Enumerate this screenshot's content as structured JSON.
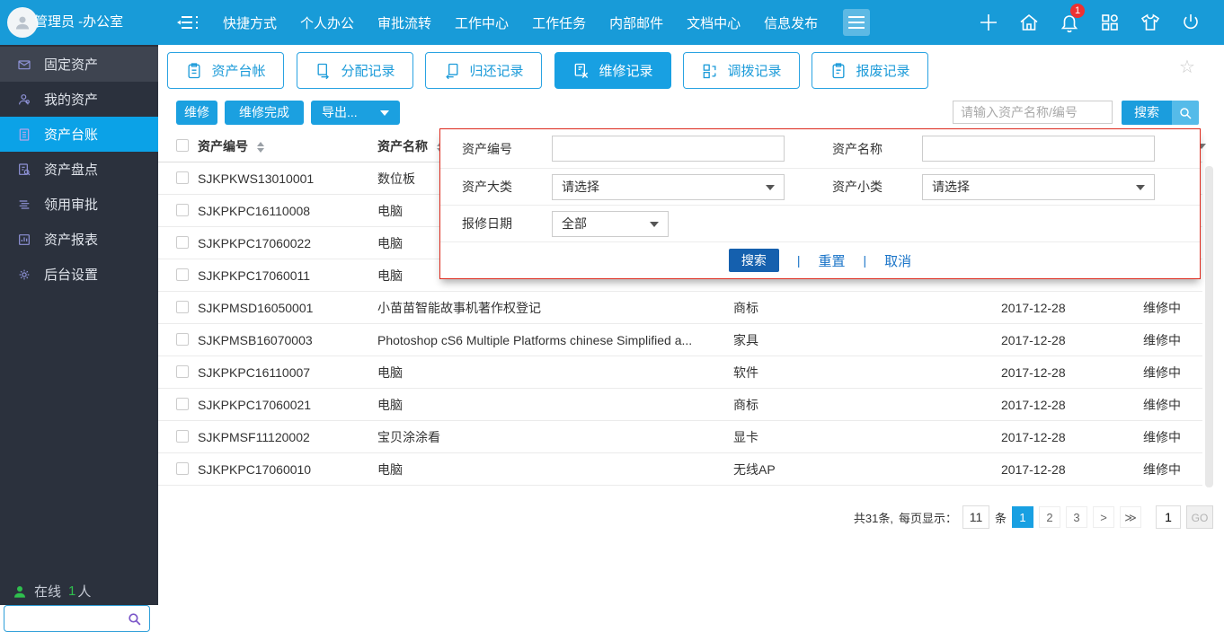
{
  "topbar": {
    "user": "管理员 -办公室",
    "nav": [
      {
        "label": "快捷方式"
      },
      {
        "label": "个人办公"
      },
      {
        "label": "审批流转"
      },
      {
        "label": "工作中心"
      },
      {
        "label": "工作任务"
      },
      {
        "label": "内部邮件"
      },
      {
        "label": "文档中心"
      },
      {
        "label": "信息发布"
      }
    ],
    "notification_badge": "1"
  },
  "sidebar": {
    "items": [
      {
        "label": "固定资产"
      },
      {
        "label": "我的资产"
      },
      {
        "label": "资产台账"
      },
      {
        "label": "资产盘点"
      },
      {
        "label": "领用审批"
      },
      {
        "label": "资产报表"
      },
      {
        "label": "后台设置"
      }
    ],
    "online_label": "在线",
    "online_count": "1",
    "online_unit": "人"
  },
  "tabs": [
    {
      "label": "资产台帐"
    },
    {
      "label": "分配记录"
    },
    {
      "label": "归还记录"
    },
    {
      "label": "维修记录"
    },
    {
      "label": "调拨记录"
    },
    {
      "label": "报废记录"
    }
  ],
  "toolbar": {
    "repair": "维修",
    "repair_done": "维修完成",
    "export": "导出...",
    "search_placeholder": "请输入资产名称/编号",
    "search": "搜索"
  },
  "filter": {
    "asset_code_label": "资产编号",
    "asset_name_label": "资产名称",
    "category_label": "资产大类",
    "subcategory_label": "资产小类",
    "date_label": "报修日期",
    "category_value": "请选择",
    "subcategory_value": "请选择",
    "date_value": "全部",
    "search": "搜索",
    "reset": "重置",
    "cancel": "取消"
  },
  "table": {
    "headers": {
      "code": "资产编号",
      "name": "资产名称"
    },
    "rows": [
      {
        "code": "SJKPKWS13010001",
        "name": "数位板",
        "category": "",
        "date": "",
        "status": ""
      },
      {
        "code": "SJKPKPC16110008",
        "name": "电脑",
        "category": "",
        "date": "",
        "status": ""
      },
      {
        "code": "SJKPKPC17060022",
        "name": "电脑",
        "category": "",
        "date": "",
        "status": ""
      },
      {
        "code": "SJKPKPC17060011",
        "name": "电脑",
        "category": "",
        "date": "",
        "status": ""
      },
      {
        "code": "SJKPMSD16050001",
        "name": "小苗苗智能故事机著作权登记",
        "category": "商标",
        "date": "2017-12-28",
        "status": "维修中"
      },
      {
        "code": "SJKPMSB16070003",
        "name": "Photoshop cS6 Multiple Platforms chinese Simplified a...",
        "category": "家具",
        "date": "2017-12-28",
        "status": "维修中"
      },
      {
        "code": "SJKPKPC16110007",
        "name": "电脑",
        "category": "软件",
        "date": "2017-12-28",
        "status": "维修中"
      },
      {
        "code": "SJKPKPC17060021",
        "name": "电脑",
        "category": "商标",
        "date": "2017-12-28",
        "status": "维修中"
      },
      {
        "code": "SJKPMSF11120002",
        "name": "宝贝涂涂看",
        "category": "显卡",
        "date": "2017-12-28",
        "status": "维修中"
      },
      {
        "code": "SJKPKPC17060010",
        "name": "电脑",
        "category": "无线AP",
        "date": "2017-12-28",
        "status": "维修中"
      }
    ]
  },
  "pagination": {
    "total": "共31条,",
    "per_page_label": "每页显示：",
    "per_page": "11",
    "unit": "条",
    "pages": [
      {
        "label": "1"
      },
      {
        "label": "2"
      },
      {
        "label": "3"
      }
    ],
    "next": ">",
    "last": "≫",
    "goto": "1",
    "go": "GO"
  },
  "colors": {
    "topbar_blue": "#189bd8",
    "accent_blue": "#18a0e2",
    "sidebar_dark": "#2b313d",
    "sidebar_active": "#0ba2e7",
    "panel_border_red": "#dd291c",
    "filter_search_blue": "#1560ae",
    "badge_red": "#ee3131"
  }
}
